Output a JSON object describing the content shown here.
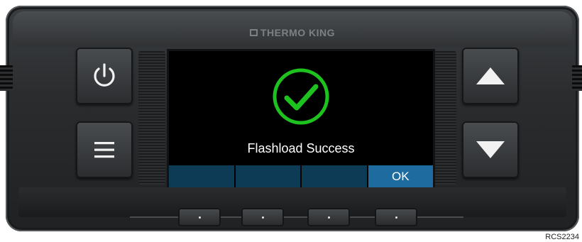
{
  "brand": {
    "name": "THERMO KING"
  },
  "screen": {
    "message": "Flashload Success",
    "status_icon": "check-circle-icon",
    "status_color": "#1ec21e",
    "softkeys": [
      "",
      "",
      "",
      "OK"
    ]
  },
  "buttons": {
    "power_icon": "power-icon",
    "menu_icon": "menu-icon",
    "up_icon": "arrow-up-icon",
    "down_icon": "arrow-down-icon"
  },
  "function_keys": [
    "•",
    "•",
    "•",
    "•"
  ],
  "figure_ref": "RCS2234"
}
